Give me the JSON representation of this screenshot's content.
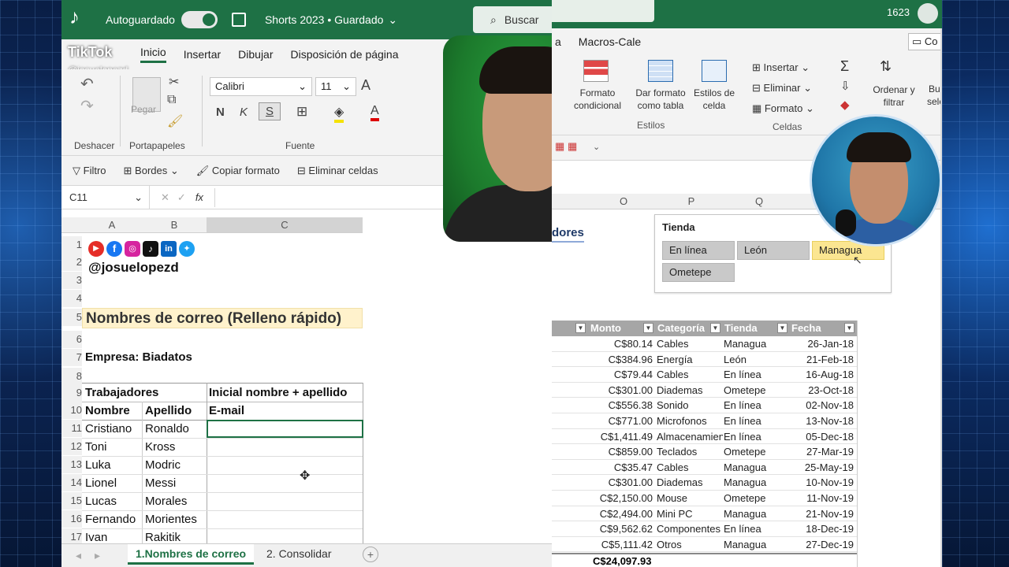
{
  "left": {
    "app": {
      "brand": "TikTok",
      "autosave": "Autoguardado",
      "title": "Shorts 2023 • Guardado",
      "search": "Buscar",
      "watermark_user": "@josuelopezd"
    },
    "menu": [
      "Inicio",
      "Insertar",
      "Dibujar",
      "Disposición de página"
    ],
    "ribbon": {
      "undo": "Deshacer",
      "clipboard": "Portapapeles",
      "paste": "Pegar",
      "font_group": "Fuente",
      "font_name": "Calibri",
      "font_size": "11",
      "bold": "N",
      "italic": "K",
      "underline": "S",
      "grow_font": "A"
    },
    "toolrow": [
      "Filtro",
      "Bordes",
      "Copiar formato",
      "Eliminar celdas"
    ],
    "formula_bar": {
      "namebox": "C11",
      "fx": "fx"
    },
    "columns": [
      "A",
      "B",
      "C"
    ],
    "rows": [
      "1",
      "2",
      "3",
      "4",
      "5",
      "6",
      "7",
      "8",
      "9",
      "10",
      "11",
      "12",
      "13",
      "14",
      "15",
      "16",
      "17"
    ],
    "cells": {
      "handle": "@josuelopezd",
      "heading": "Nombres de correo (Relleno rápido)",
      "company": "Empresa: Biadatos",
      "workers": "Trabajadores",
      "rule": "Inicial nombre + apellido",
      "col_name": "Nombre",
      "col_last": "Apellido",
      "col_email": "E-mail"
    },
    "people": [
      {
        "first": "Cristiano",
        "last": "Ronaldo"
      },
      {
        "first": "Toni",
        "last": "Kross"
      },
      {
        "first": "Luka",
        "last": "Modric"
      },
      {
        "first": "Lionel",
        "last": "Messi"
      },
      {
        "first": "Lucas",
        "last": "Morales"
      },
      {
        "first": "Fernando",
        "last": "Morientes"
      },
      {
        "first": "Ivan",
        "last": "Rakitik"
      }
    ],
    "tabs": [
      "1.Nombres de correo",
      "2. Consolidar"
    ],
    "social_icons": [
      "youtube-icon",
      "facebook-icon",
      "instagram-icon",
      "tiktok-icon",
      "linkedin-icon",
      "twitter-icon"
    ]
  },
  "right": {
    "titlebar_num": "1623",
    "menu": [
      "a",
      "Macros-Cale"
    ],
    "comment_btn": "Co",
    "ribbon": {
      "cond_format": "Formato condicional",
      "table_format": "Dar formato como tabla",
      "cell_styles": "Estilos de celda",
      "styles_group": "Estilos",
      "insert": "Insertar",
      "delete": "Eliminar",
      "format": "Formato",
      "cells_group": "Celdas",
      "sort_filter": "Ordenar y filtrar",
      "find": "Bus",
      "select": "selec"
    },
    "columns": [
      "O",
      "P",
      "Q"
    ],
    "partial_title": "dores",
    "slicer": {
      "title": "Tienda",
      "buttons": [
        "En línea",
        "León",
        "Managua",
        "Ometepe"
      ],
      "selected": "Managua"
    },
    "table_headers": [
      "Monto",
      "Categoría",
      "Tienda",
      "Fecha"
    ],
    "table_rows": [
      [
        "C$80.14",
        "Cables",
        "Managua",
        "26-Jan-18"
      ],
      [
        "C$384.96",
        "Energía",
        "León",
        "21-Feb-18"
      ],
      [
        "C$79.44",
        "Cables",
        "En línea",
        "16-Aug-18"
      ],
      [
        "C$301.00",
        "Diademas",
        "Ometepe",
        "23-Oct-18"
      ],
      [
        "C$556.38",
        "Sonido",
        "En línea",
        "02-Nov-18"
      ],
      [
        "C$771.00",
        "Microfonos",
        "En línea",
        "13-Nov-18"
      ],
      [
        "C$1,411.49",
        "Almacenamiento",
        "En línea",
        "05-Dec-18"
      ],
      [
        "C$859.00",
        "Teclados",
        "Ometepe",
        "27-Mar-19"
      ],
      [
        "C$35.47",
        "Cables",
        "Managua",
        "25-May-19"
      ],
      [
        "C$301.00",
        "Diademas",
        "Managua",
        "10-Nov-19"
      ],
      [
        "C$2,150.00",
        "Mouse",
        "Ometepe",
        "11-Nov-19"
      ],
      [
        "C$2,494.00",
        "Mini PC",
        "Managua",
        "21-Nov-19"
      ],
      [
        "C$9,562.62",
        "Componentes",
        "En línea",
        "18-Dec-19"
      ],
      [
        "C$5,111.42",
        "Otros",
        "Managua",
        "27-Dec-19"
      ]
    ],
    "total": "C$24,097.93"
  },
  "colors": {
    "excel_green": "#1e7145",
    "slicer_selected": "#fbe691",
    "table_header": "#a6a6a6",
    "heading_fill": "#fff2cc"
  }
}
